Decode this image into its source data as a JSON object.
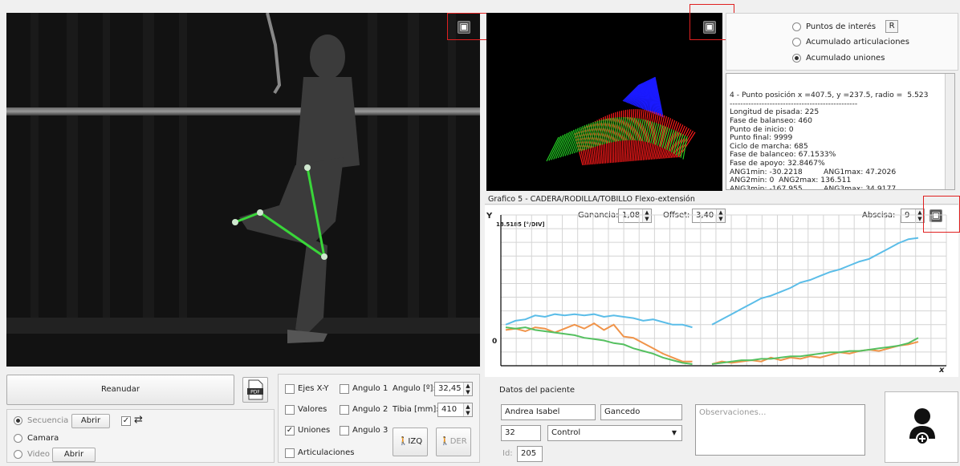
{
  "radios": {
    "puntos": "Puntos de interés",
    "puntos_btn": "R",
    "acum_art": "Acumulado articulaciones",
    "acum_uni": "Acumulado uniones"
  },
  "info_lines": [
    "4 - Punto posición x =407.5, y =237.5, radio =  5.523",
    "------------------------------------------------",
    "Longitud de pisada: 225",
    "Fase de balanseo: 460",
    "Punto de inicio: 0",
    "Punto final: 9999",
    "Ciclo de marcha: 685",
    "Fase de balanceo: 67.1533%",
    "Fase de apoyo: 32.8467%",
    "ANG1min: -30.2218         ANG1max: 47.2026",
    "ANG2min: 0  ANG2max: 136.511",
    "ANG3min: -167.955         ANG3max: 34.9177"
  ],
  "chart": {
    "title": "Grafico 5 - CADERA/RODILLA/TOBILLO Flexo-extensión",
    "ganancia_label": "Ganancia:",
    "ganancia": "1,08",
    "offset_label": "Offset:",
    "offset": "3,40",
    "abscisa_label": "Abscisa:",
    "abscisa": "9",
    "y_axis": "Y",
    "x_axis": "x",
    "scale": "18.5185 [°/DIV]",
    "zero": "0"
  },
  "chart_data": {
    "type": "line",
    "ylabel": "Y",
    "xlabel": "x",
    "series": [
      {
        "color": "#5bbde8",
        "values": [
          0.3,
          0.33,
          0.34,
          0.37,
          0.36,
          0.38,
          0.37,
          0.38,
          0.37,
          0.38,
          0.36,
          0.37,
          0.36,
          0.35,
          0.33,
          0.34,
          0.32,
          0.3,
          0.3,
          0.28,
          null,
          0.3,
          0.34,
          0.38,
          0.42,
          0.46,
          0.5,
          0.52,
          0.55,
          0.58,
          0.62,
          0.64,
          0.67,
          0.7,
          0.72,
          0.75,
          0.78,
          0.8,
          0.84,
          0.88,
          0.92,
          0.95,
          0.96
        ]
      },
      {
        "color": "#f0944a",
        "values": [
          0.26,
          0.27,
          0.25,
          0.28,
          0.27,
          0.24,
          0.27,
          0.3,
          0.27,
          0.31,
          0.26,
          0.3,
          0.21,
          0.2,
          0.16,
          0.12,
          0.08,
          0.05,
          0.02,
          0.02,
          null,
          0.0,
          0.02,
          0.01,
          0.02,
          0.03,
          0.02,
          0.05,
          0.03,
          0.05,
          0.04,
          0.06,
          0.05,
          0.07,
          0.09,
          0.08,
          0.1,
          0.11,
          0.1,
          0.12,
          0.14,
          0.15,
          0.17
        ]
      },
      {
        "color": "#55c060",
        "values": [
          0.28,
          0.27,
          0.28,
          0.26,
          0.25,
          0.24,
          0.23,
          0.22,
          0.2,
          0.19,
          0.18,
          0.16,
          0.15,
          0.12,
          0.1,
          0.08,
          0.05,
          0.03,
          0.01,
          0.0,
          null,
          0.0,
          0.01,
          0.02,
          0.03,
          0.03,
          0.04,
          0.04,
          0.05,
          0.06,
          0.06,
          0.07,
          0.08,
          0.09,
          0.09,
          0.1,
          0.1,
          0.11,
          0.12,
          0.13,
          0.14,
          0.16,
          0.2
        ]
      }
    ]
  },
  "controls": {
    "reanudar": "Reanudar",
    "pdf": "PDF",
    "secuencia": "Secuencia",
    "abrir": "Abrir",
    "camara": "Camara",
    "video": "Video",
    "check": "✓",
    "loop": "⇄",
    "ejes": "Ejes X-Y",
    "valores": "Valores",
    "uniones": "Uniones",
    "articulaciones": "Articulaciones",
    "angulo1": "Angulo 1",
    "angulo2": "Angulo 2",
    "angulo3": "Angulo 3",
    "angulo_label": "Angulo [º]:",
    "angulo_val": "32,45",
    "tibia_label": "Tibia [mm]:",
    "tibia_val": "410",
    "izq": "IZQ",
    "der": "DER"
  },
  "patient": {
    "title": "Datos del paciente",
    "nombre": "Andrea Isabel",
    "apellido": "Gancedo",
    "edad": "32",
    "grupo": "Control",
    "id_label": "Id:",
    "id": "205",
    "observaciones_placeholder": "Observaciones..."
  },
  "colors": {
    "skeleton": "#39d639",
    "red_highlight": "#e02020"
  }
}
